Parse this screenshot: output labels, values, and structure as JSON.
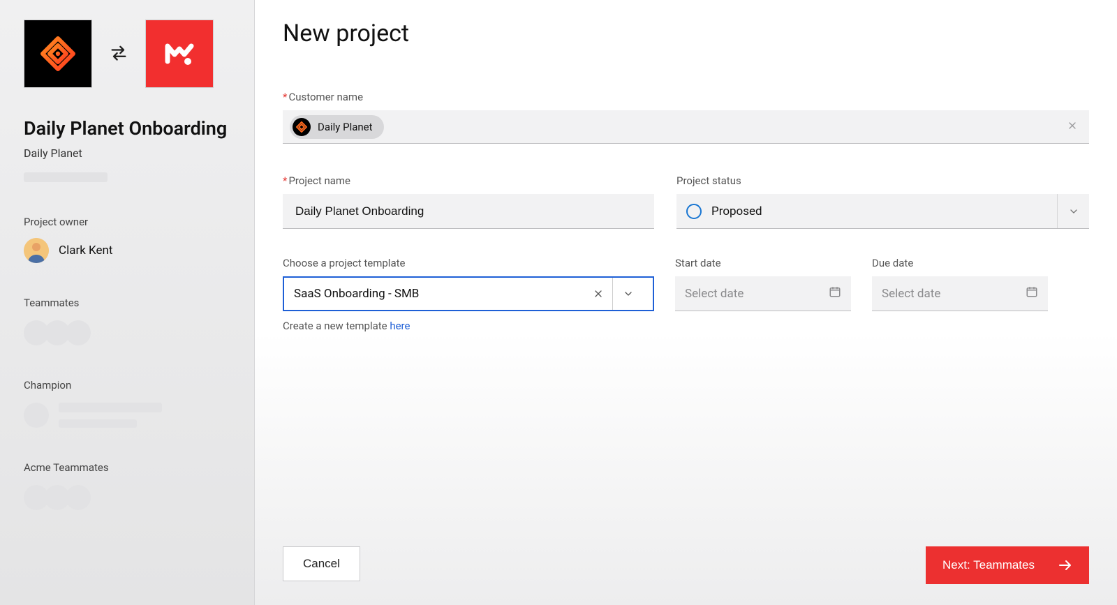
{
  "sidebar": {
    "title": "Daily Planet Onboarding",
    "subtitle": "Daily Planet",
    "project_owner_label": "Project owner",
    "project_owner_name": "Clark Kent",
    "teammates_label": "Teammates",
    "champion_label": "Champion",
    "acme_teammates_label": "Acme Teammates"
  },
  "main": {
    "title": "New project",
    "customer_name_label": "Customer name",
    "customer_chip": "Daily Planet",
    "project_name_label": "Project name",
    "project_name_value": "Daily Planet Onboarding",
    "status_label": "Project status",
    "status_value": "Proposed",
    "template_label": "Choose a project template",
    "template_value": "SaaS Onboarding - SMB",
    "template_hint_text": "Create a new template ",
    "template_hint_link": "here",
    "start_date_label": "Start date",
    "start_date_placeholder": "Select date",
    "due_date_label": "Due date",
    "due_date_placeholder": "Select date",
    "cancel_label": "Cancel",
    "next_label": "Next: Teammates"
  },
  "colors": {
    "accent_red": "#ec3030",
    "link_blue": "#1e5fd6"
  }
}
